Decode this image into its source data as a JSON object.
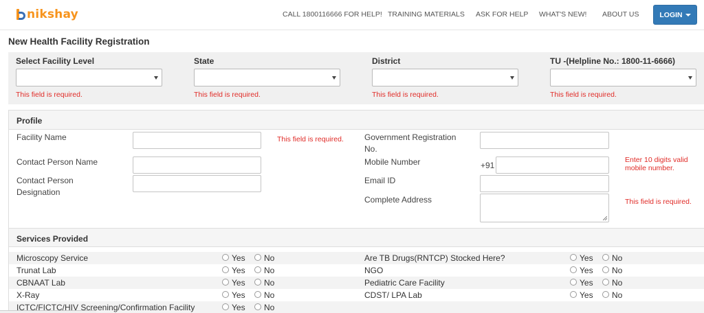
{
  "brand": {
    "logo_text": "nikshay"
  },
  "nav": {
    "helpline": "CALL 1800116666 FOR HELP!",
    "training": "TRAINING MATERIALS",
    "ask": "ASK FOR HELP",
    "whats_new": "WHAT'S NEW!",
    "about": "ABOUT US",
    "login": "LOGIN"
  },
  "page_title": "New Health Facility Registration",
  "filters": [
    {
      "label": "Select Facility Level",
      "error": "This field is required."
    },
    {
      "label": "State",
      "error": "This field is required."
    },
    {
      "label": "District",
      "error": "This field is required."
    },
    {
      "label": "TU -(Helpline No.: 1800-11-6666)",
      "error": "This field is required."
    }
  ],
  "profile": {
    "heading": "Profile",
    "facility_name": {
      "label": "Facility Name",
      "error": "This field is required."
    },
    "contact_person_name": {
      "label": "Contact Person Name"
    },
    "contact_person_designation": {
      "label": "Contact Person Designation"
    },
    "govt_registration_no": {
      "label": "Government Registration No."
    },
    "mobile_number": {
      "label": "Mobile Number",
      "prefix": "+91",
      "error": "Enter 10 digits valid mobile number."
    },
    "email_id": {
      "label": "Email ID"
    },
    "complete_address": {
      "label": "Complete Address",
      "error": "This field is required."
    }
  },
  "services": {
    "heading": "Services Provided",
    "yes_label": "Yes",
    "no_label": "No",
    "left": [
      "Microscopy Service",
      "Trunat Lab",
      "CBNAAT Lab",
      "X-Ray",
      "ICTC/FICTC/HIV Screening/Confirmation Facility"
    ],
    "right": [
      "Are TB Drugs(RNTCP) Stocked Here?",
      "NGO",
      "Pediatric Care Facility",
      "CDST/ LPA Lab"
    ]
  },
  "colors": {
    "brand_orange": "#f7941d",
    "brand_blue": "#3a6fb5",
    "error_red": "#e02b27",
    "login_blue": "#337ab7"
  }
}
